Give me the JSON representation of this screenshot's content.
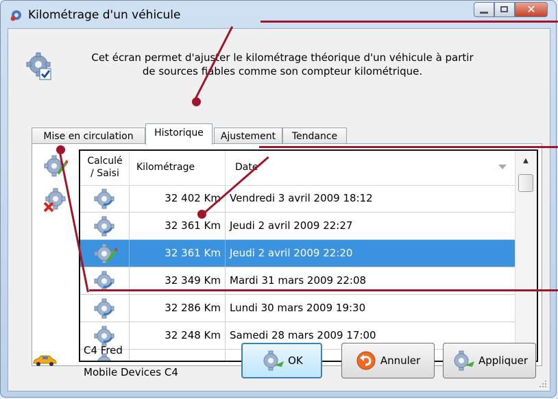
{
  "window": {
    "title": "Kilométrage d'un véhicule"
  },
  "description": "Cet écran permet d'ajuster le kilométrage théorique d'un véhicule à partir de sources fiables comme son compteur kilométrique.",
  "tabs": [
    {
      "label": "Mise en circulation"
    },
    {
      "label": "Historique"
    },
    {
      "label": "Ajustement"
    },
    {
      "label": "Tendance"
    }
  ],
  "grid": {
    "headers": {
      "source": "Calculé / Saisi",
      "km": "Kilométrage",
      "date": "Date"
    },
    "rows": [
      {
        "icon": "calculated-gear-icon",
        "km": "32 402 Km",
        "date": "Vendredi 3 avril 2009 18:12",
        "selected": false
      },
      {
        "icon": "calculated-gear-icon",
        "km": "32 361 Km",
        "date": "Jeudi 2 avril 2009 22:27",
        "selected": false
      },
      {
        "icon": "manual-entry-gear-icon",
        "km": "32 361 Km",
        "date": "Jeudi 2 avril 2009 22:20",
        "selected": true
      },
      {
        "icon": "calculated-gear-icon",
        "km": "32 349 Km",
        "date": "Mardi 31 mars 2009 22:08",
        "selected": false
      },
      {
        "icon": "calculated-gear-icon",
        "km": "32 286 Km",
        "date": "Lundi 30 mars 2009 19:30",
        "selected": false
      },
      {
        "icon": "calculated-gear-icon",
        "km": "32 248 Km",
        "date": "Samedi 28 mars 2009 17:00",
        "selected": false
      }
    ]
  },
  "vehicle": {
    "name": "C4 Fred",
    "device": "Mobile Devices C4"
  },
  "buttons": {
    "ok": "OK",
    "cancel": "Annuler",
    "apply": "Appliquer"
  },
  "colors": {
    "selection": "#3b92df",
    "annotation": "#a0142c"
  }
}
